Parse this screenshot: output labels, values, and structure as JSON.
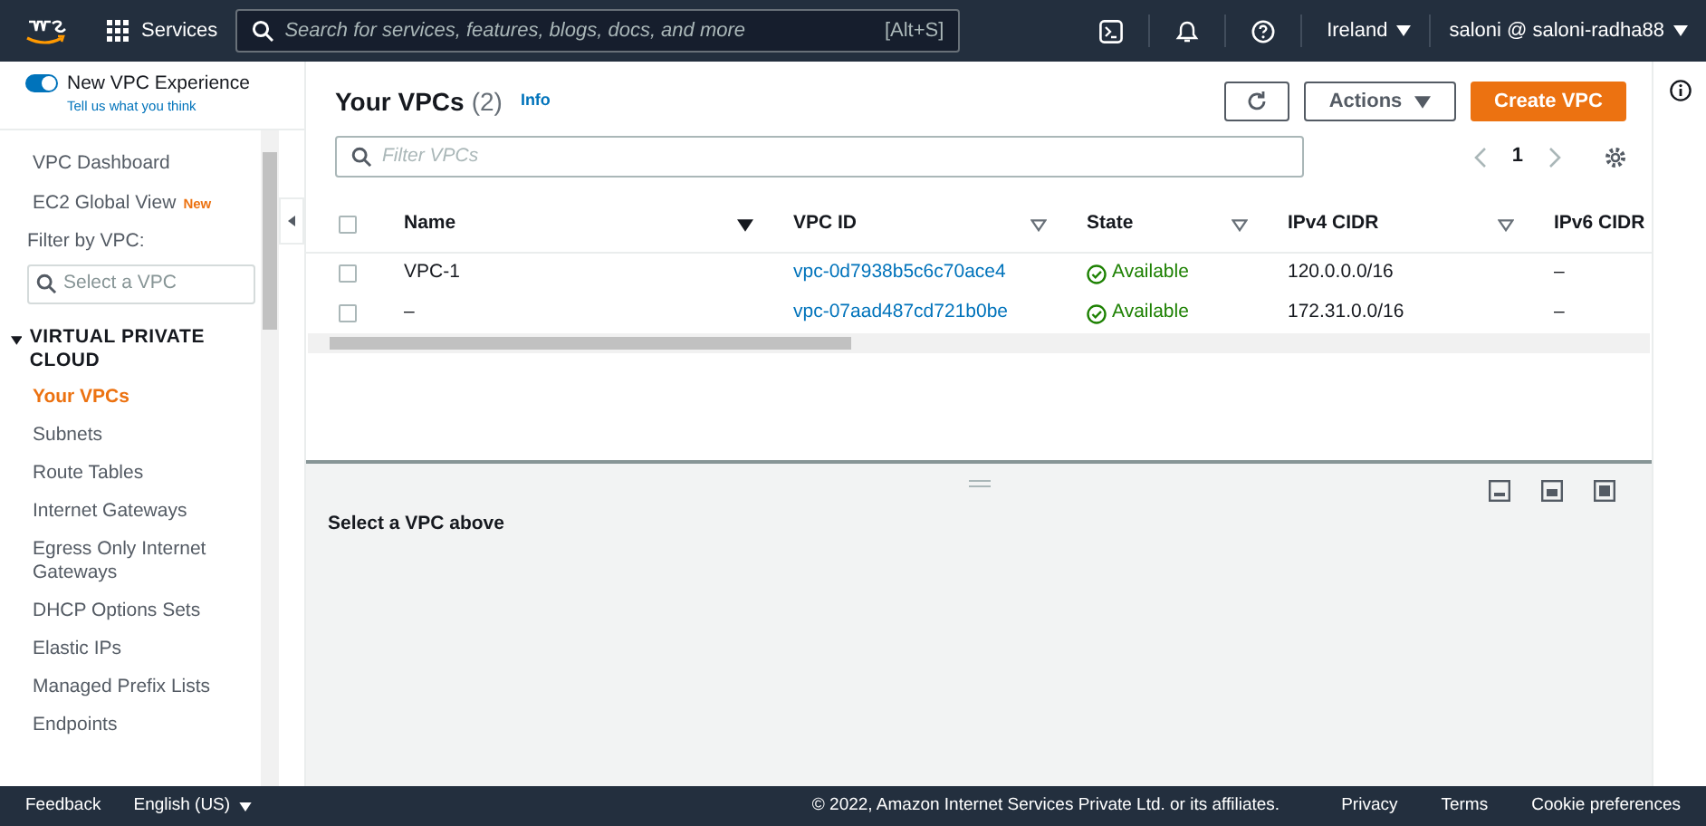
{
  "top_nav": {
    "services": "Services",
    "search_placeholder": "Search for services, features, blogs, docs, and more",
    "shortcut": "[Alt+S]",
    "region": "Ireland",
    "account": "saloni @ saloni-radha88"
  },
  "sidebar": {
    "toggle": {
      "label": "New VPC Experience",
      "on": true
    },
    "feedback_link": "Tell us what you think",
    "items": [
      {
        "label": "VPC Dashboard"
      },
      {
        "label": "EC2 Global View",
        "badge": "New"
      }
    ],
    "filter_label": "Filter by VPC:",
    "filter_placeholder": "Select a VPC",
    "section": {
      "title": "VIRTUAL PRIVATE CLOUD",
      "expanded": true,
      "items": [
        {
          "label": "Your VPCs",
          "selected": true
        },
        {
          "label": "Subnets",
          "selected": false
        },
        {
          "label": "Route Tables",
          "selected": false
        },
        {
          "label": "Internet Gateways",
          "selected": false
        },
        {
          "label": "Egress Only Internet Gateways",
          "selected": false
        },
        {
          "label": "DHCP Options Sets",
          "selected": false
        },
        {
          "label": "Elastic IPs",
          "selected": false
        },
        {
          "label": "Managed Prefix Lists",
          "selected": false
        },
        {
          "label": "Endpoints",
          "selected": false
        }
      ]
    }
  },
  "main": {
    "title": "Your VPCs",
    "count": "(2)",
    "info": "Info",
    "actions": "Actions",
    "create": "Create VPC",
    "filter_placeholder": "Filter VPCs",
    "page": "1",
    "table": {
      "columns": [
        {
          "label": "Name",
          "sorted": true
        },
        {
          "label": "VPC ID",
          "sorted": false
        },
        {
          "label": "State",
          "sorted": false
        },
        {
          "label": "IPv4 CIDR",
          "sorted": false
        },
        {
          "label": "IPv6 CIDR"
        }
      ],
      "all_checked": false,
      "rows": [
        {
          "checked": false,
          "name": "VPC-1",
          "vpc_id": "vpc-0d7938b5c6c70ace4",
          "state": "Available",
          "ipv4": "120.0.0.0/16",
          "ipv6": "–"
        },
        {
          "checked": false,
          "name": "–",
          "vpc_id": "vpc-07aad487cd721b0be",
          "state": "Available",
          "ipv4": "172.31.0.0/16",
          "ipv6": "–"
        }
      ]
    },
    "detail": "Select a VPC above"
  },
  "footer": {
    "feedback": "Feedback",
    "language": "English (US)",
    "copyright": "© 2022, Amazon Internet Services Private Ltd. or its affiliates.",
    "links": [
      "Privacy",
      "Terms",
      "Cookie preferences"
    ]
  }
}
